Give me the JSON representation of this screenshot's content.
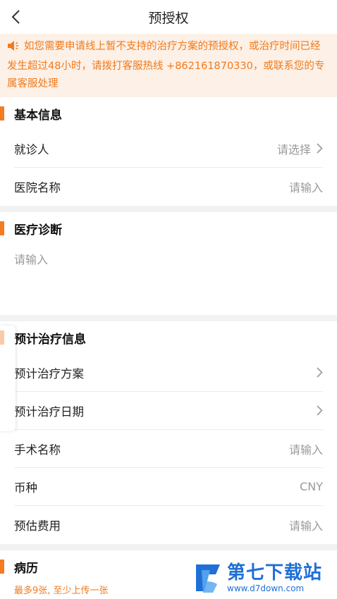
{
  "header": {
    "title": "预授权"
  },
  "notice": {
    "text": "如您需要申请线上暂不支持的治疗方案的预授权，或治疗时间已经发生超过48小时，请拨打客服热线 +862161870330，或联系您的专属客服处理"
  },
  "basic_info": {
    "heading": "基本信息",
    "rows": [
      {
        "label": "就诊人",
        "value": "请选择"
      },
      {
        "label": "医院名称",
        "value": "请输入"
      }
    ]
  },
  "diagnosis": {
    "heading": "医疗诊断",
    "placeholder": "请输入"
  },
  "treatment": {
    "heading": "预计治疗信息",
    "rows": [
      {
        "label": "预计治疗方案",
        "value": ""
      },
      {
        "label": "预计治疗日期",
        "value": ""
      },
      {
        "label": "手术名称",
        "value": "请输入"
      },
      {
        "label": "币种",
        "value": "CNY"
      },
      {
        "label": "预估费用",
        "value": "请输入"
      }
    ]
  },
  "records": {
    "heading": "病历",
    "hint": "最多9张, 至少上传一张"
  },
  "watermark": {
    "name": "第七下载站",
    "url": "www.d7down.com"
  },
  "colors": {
    "accent": "#f47b20",
    "notice_bg": "#fdf0e6",
    "watermark": "#1f6fd6"
  }
}
